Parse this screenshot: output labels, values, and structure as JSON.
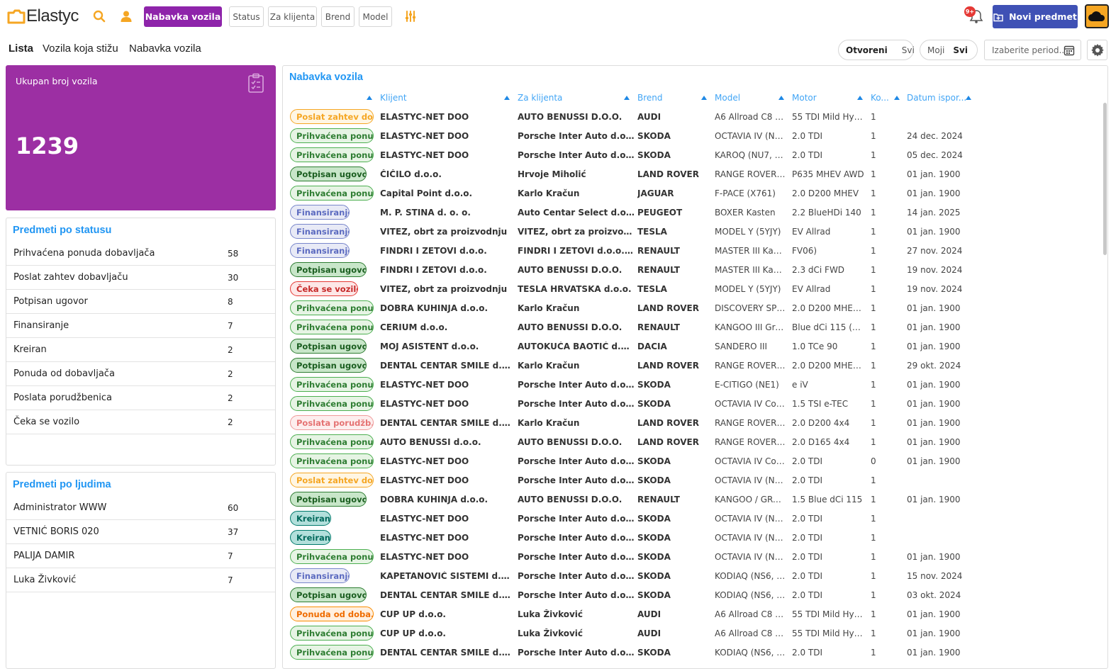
{
  "brand": {
    "name": "Elastyc"
  },
  "topbar": {
    "active_module": "Nabavka vozila",
    "filters": [
      "Status",
      "Za klijenta",
      "Brend",
      "Model"
    ],
    "notification_badge": "9+",
    "new_button": "Novi predmet"
  },
  "subnav": {
    "tabs": [
      "Lista",
      "Vozila koja stižu",
      "Nabavka vozila"
    ],
    "active_tab": "Lista",
    "scope": {
      "open": "Otvoreni",
      "all": "Svi"
    },
    "owner": {
      "mine": "Moji",
      "all": "Svi"
    },
    "period_placeholder": "Izaberite period.."
  },
  "total": {
    "label": "Ukupan broj vozila",
    "value": "1239"
  },
  "by_status": {
    "title": "Predmeti po statusu",
    "items": [
      {
        "label": "Prihvaćena ponuda dobavljača",
        "count": "58"
      },
      {
        "label": "Poslat zahtev dobavljaču",
        "count": "30"
      },
      {
        "label": "Potpisan ugovor",
        "count": "8"
      },
      {
        "label": "Finansiranje",
        "count": "7"
      },
      {
        "label": "Kreiran",
        "count": "2"
      },
      {
        "label": "Ponuda od dobavljača",
        "count": "2"
      },
      {
        "label": "Poslata porudžbenica",
        "count": "2"
      },
      {
        "label": "Čeka se vozilo",
        "count": "2"
      }
    ]
  },
  "by_people": {
    "title": "Predmeti po ljudima",
    "items": [
      {
        "label": "Administrator WWW",
        "count": "60"
      },
      {
        "label": "VETNIĆ BORIS 020",
        "count": "37"
      },
      {
        "label": "PALIJA DAMIR",
        "count": "7"
      },
      {
        "label": "Luka Živković",
        "count": "7"
      }
    ]
  },
  "table": {
    "title": "Nabavka vozila",
    "columns": [
      "Klijent",
      "Za klijenta",
      "Brend",
      "Model",
      "Motor",
      "Ko...",
      "Datum ispor..."
    ],
    "status_colors": {
      "poslat": {
        "fg": "#f5a623",
        "bg": "#fff6e3"
      },
      "prihvacena": {
        "fg": "#2e7d32",
        "bg": "#e6f4e4",
        "border": "#4caf50"
      },
      "potpisan": {
        "fg": "#1b5e20",
        "bg": "#c8e6c9",
        "border": "#2e7d32"
      },
      "finansiranje": {
        "fg": "#5c6bc0",
        "bg": "#e8eaf6",
        "border": "#7986cb"
      },
      "ceka": {
        "fg": "#c62828",
        "bg": "#fde7e7",
        "border": "#e53935"
      },
      "porudzbenica": {
        "fg": "#e57373",
        "bg": "#fdeeee",
        "border": "#ef9a9a"
      },
      "kreiran": {
        "fg": "#00695c",
        "bg": "#b2dfdb",
        "border": "#00796b"
      },
      "ponuda": {
        "fg": "#ef6c00",
        "bg": "#fff0e0",
        "border": "#fb8c00"
      }
    },
    "rows": [
      {
        "status": "Poslat zahtev do...",
        "kind": "poslat",
        "client": "ELASTYC-NET DOO",
        "za": "AUTO BENUSSI D.O.O.",
        "brand": "AUDI",
        "model": "A6 Allroad C8 (4...",
        "motor": "55 TDI Mild Hybri...",
        "ko": "1",
        "date": ""
      },
      {
        "status": "Prihvaćena ponu...",
        "kind": "prihvacena",
        "client": "ELASTYC-NET DOO",
        "za": "Porsche Inter Auto d.o.o",
        "brand": "SKODA",
        "model": "OCTAVIA IV (NX...",
        "motor": "2.0 TDI",
        "ko": "1",
        "date": "24 dec. 2024"
      },
      {
        "status": "Prihvaćena ponu...",
        "kind": "prihvacena",
        "client": "ELASTYC-NET DOO",
        "za": "Porsche Inter Auto d.o.o",
        "brand": "SKODA",
        "model": "KAROQ (NU7, N...",
        "motor": "2.0 TDI",
        "ko": "1",
        "date": "05 dec. 2024"
      },
      {
        "status": "Potpisan ugovor",
        "kind": "potpisan",
        "client": "ČIČILO d.o.o.",
        "za": "Hrvoje Miholić",
        "brand": "LAND ROVER",
        "model": "RANGE ROVER S...",
        "motor": "P635 MHEV AWD",
        "ko": "1",
        "date": "01 jan. 1900"
      },
      {
        "status": "Prihvaćena ponu...",
        "kind": "prihvacena",
        "client": "Capital Point d.o.o.",
        "za": "Karlo Kračun",
        "brand": "JAGUAR",
        "model": "F-PACE (X761)",
        "motor": "2.0 D200 MHEV",
        "ko": "1",
        "date": "01 jan. 1900"
      },
      {
        "status": "Finansiranje",
        "kind": "finansiranje",
        "client": "M. P. STINA d. o. o.",
        "za": "Auto Centar Select d.o.o.",
        "brand": "PEUGEOT",
        "model": "BOXER Kasten",
        "motor": "2.2 BlueHDi 140",
        "ko": "1",
        "date": "14 jan. 2025"
      },
      {
        "status": "Finansiranje",
        "kind": "finansiranje",
        "client": "VITEZ, obrt za proizvodnju",
        "za": "VITEZ, obrt za proizvodnju, ...",
        "brand": "TESLA",
        "model": "MODEL Y (5YJY)",
        "motor": "EV Allrad",
        "ko": "1",
        "date": "01 jan. 1900"
      },
      {
        "status": "Finansiranje",
        "kind": "finansiranje",
        "client": "FINDRI I ZETOVI d.o.o.",
        "za": "FINDRI I ZETOVI d.o.o. za pr...",
        "brand": "RENAULT",
        "model": "MASTER III Kaste...",
        "motor": "FV06)",
        "ko": "1",
        "date": "27 nov. 2024"
      },
      {
        "status": "Potpisan ugovor",
        "kind": "potpisan",
        "client": "FINDRI I ZETOVI d.o.o.",
        "za": "AUTO BENUSSI D.O.O.",
        "brand": "RENAULT",
        "model": "MASTER III Kaste...",
        "motor": "2.3 dCi FWD",
        "ko": "1",
        "date": "19 nov. 2024"
      },
      {
        "status": "Čeka se vozilo",
        "kind": "ceka",
        "client": "VITEZ, obrt za proizvodnju",
        "za": "TESLA HRVATSKA d.o.o.",
        "brand": "TESLA",
        "model": "MODEL Y (5YJY)",
        "motor": "EV Allrad",
        "ko": "1",
        "date": "19 nov. 2024"
      },
      {
        "status": "Prihvaćena ponu...",
        "kind": "prihvacena",
        "client": "DOBRA KUHINJA d.o.o.",
        "za": "Karlo Kračun",
        "brand": "LAND ROVER",
        "model": "DISCOVERY SPO...",
        "motor": "2.0 D200 MHEV ...",
        "ko": "1",
        "date": "01 jan. 1900"
      },
      {
        "status": "Prihvaćena ponu...",
        "kind": "prihvacena",
        "client": "CERIUM d.o.o.",
        "za": "AUTO BENUSSI D.O.O.",
        "brand": "RENAULT",
        "model": "KANGOO III Groß...",
        "motor": "Blue dCi 115 (KJ...",
        "ko": "1",
        "date": "01 jan. 1900"
      },
      {
        "status": "Potpisan ugovor",
        "kind": "potpisan",
        "client": "MOJ ASISTENT d.o.o.",
        "za": "AUTOKUĆA BAOTIĆ d.o.o.",
        "brand": "DACIA",
        "model": "SANDERO III",
        "motor": "1.0 TCe 90",
        "ko": "1",
        "date": "01 jan. 1900"
      },
      {
        "status": "Potpisan ugovor",
        "kind": "potpisan",
        "client": "DENTAL CENTAR SMILE d.o.o.",
        "za": "Karlo Kračun",
        "brand": "LAND ROVER",
        "model": "RANGE ROVER ...",
        "motor": "2.0 D200 MHEV ...",
        "ko": "1",
        "date": "29 okt. 2024"
      },
      {
        "status": "Prihvaćena ponu...",
        "kind": "prihvacena",
        "client": "ELASTYC-NET DOO",
        "za": "Porsche Inter Auto d.o.o",
        "brand": "SKODA",
        "model": "E-CITIGO (NE1)",
        "motor": "e iV",
        "ko": "1",
        "date": "01 jan. 1900"
      },
      {
        "status": "Prihvaćena ponu...",
        "kind": "prihvacena",
        "client": "ELASTYC-NET DOO",
        "za": "Porsche Inter Auto d.o.o",
        "brand": "SKODA",
        "model": "OCTAVIA IV Com...",
        "motor": "1.5 TSI e-TEC",
        "ko": "1",
        "date": "01 jan. 1900"
      },
      {
        "status": "Poslata porudžb...",
        "kind": "porudzbenica",
        "client": "DENTAL CENTAR SMILE d.o.o.",
        "za": "Karlo Kračun",
        "brand": "LAND ROVER",
        "model": "RANGE ROVER ...",
        "motor": "2.0 D200 4x4",
        "ko": "1",
        "date": "01 jan. 1900"
      },
      {
        "status": "Prihvaćena ponu...",
        "kind": "prihvacena",
        "client": "AUTO BENUSSI d.o.o.",
        "za": "AUTO BENUSSI D.O.O.",
        "brand": "LAND ROVER",
        "model": "RANGE ROVER E...",
        "motor": "2.0 D165 4x4",
        "ko": "1",
        "date": "01 jan. 1900"
      },
      {
        "status": "Prihvaćena ponu...",
        "kind": "prihvacena",
        "client": "ELASTYC-NET DOO",
        "za": "Porsche Inter Auto d.o.o",
        "brand": "SKODA",
        "model": "OCTAVIA IV Com...",
        "motor": "2.0 TDI",
        "ko": "0",
        "date": "01 jan. 1900"
      },
      {
        "status": "Poslat zahtev do...",
        "kind": "poslat",
        "client": "ELASTYC-NET DOO",
        "za": "Porsche Inter Auto d.o.o",
        "brand": "SKODA",
        "model": "OCTAVIA IV (NX...",
        "motor": "2.0 TDI",
        "ko": "1",
        "date": ""
      },
      {
        "status": "Potpisan ugovor",
        "kind": "potpisan",
        "client": "DOBRA KUHINJA d.o.o.",
        "za": "AUTO BENUSSI D.O.O.",
        "brand": "RENAULT",
        "model": "KANGOO / GRA...",
        "motor": "1.5 Blue dCi 115",
        "ko": "1",
        "date": "01 jan. 1900"
      },
      {
        "status": "Kreiran",
        "kind": "kreiran",
        "client": "ELASTYC-NET DOO",
        "za": "Porsche Inter Auto d.o.o",
        "brand": "SKODA",
        "model": "OCTAVIA IV (NX...",
        "motor": "2.0 TDI",
        "ko": "1",
        "date": ""
      },
      {
        "status": "Kreiran",
        "kind": "kreiran",
        "client": "ELASTYC-NET DOO",
        "za": "Porsche Inter Auto d.o.o",
        "brand": "SKODA",
        "model": "OCTAVIA IV (NX...",
        "motor": "2.0 TDI",
        "ko": "1",
        "date": ""
      },
      {
        "status": "Prihvaćena ponu...",
        "kind": "prihvacena",
        "client": "ELASTYC-NET DOO",
        "za": "Porsche Inter Auto d.o.o",
        "brand": "SKODA",
        "model": "OCTAVIA IV (NX...",
        "motor": "2.0 TDI",
        "ko": "1",
        "date": "01 jan. 1900"
      },
      {
        "status": "Finansiranje",
        "kind": "finansiranje",
        "client": "KAPETANOVIĆ SISTEMI d.o.o.",
        "za": "Porsche Inter Auto d.o.o",
        "brand": "SKODA",
        "model": "KODIAQ (NS6, N...",
        "motor": "2.0 TDI",
        "ko": "1",
        "date": "15 nov. 2024"
      },
      {
        "status": "Potpisan ugovor",
        "kind": "potpisan",
        "client": "DENTAL CENTAR SMILE d.o.o.",
        "za": "Porsche Inter Auto d.o.o",
        "brand": "SKODA",
        "model": "KODIAQ (NS6, N...",
        "motor": "2.0 TDI",
        "ko": "1",
        "date": "03 okt. 2024"
      },
      {
        "status": "Ponuda od doba...",
        "kind": "ponuda",
        "client": "CUP UP d.o.o.",
        "za": "Luka Živković",
        "brand": "AUDI",
        "model": "A6 Allroad C8 (4...",
        "motor": "55 TDI Mild Hybri...",
        "ko": "1",
        "date": "01 jan. 1900"
      },
      {
        "status": "Prihvaćena ponu...",
        "kind": "prihvacena",
        "client": "CUP UP d.o.o.",
        "za": "Luka Živković",
        "brand": "AUDI",
        "model": "A6 Allroad C8 (4...",
        "motor": "55 TDI Mild Hybri...",
        "ko": "1",
        "date": "01 jan. 1900"
      },
      {
        "status": "Prihvaćena ponu...",
        "kind": "prihvacena",
        "client": "DENTAL CENTAR SMILE d.o.o.",
        "za": "Porsche Inter Auto d.o.o",
        "brand": "SKODA",
        "model": "KODIAQ (NS6, N...",
        "motor": "2.0 TDI",
        "ko": "1",
        "date": "01 jan. 1900"
      }
    ]
  }
}
